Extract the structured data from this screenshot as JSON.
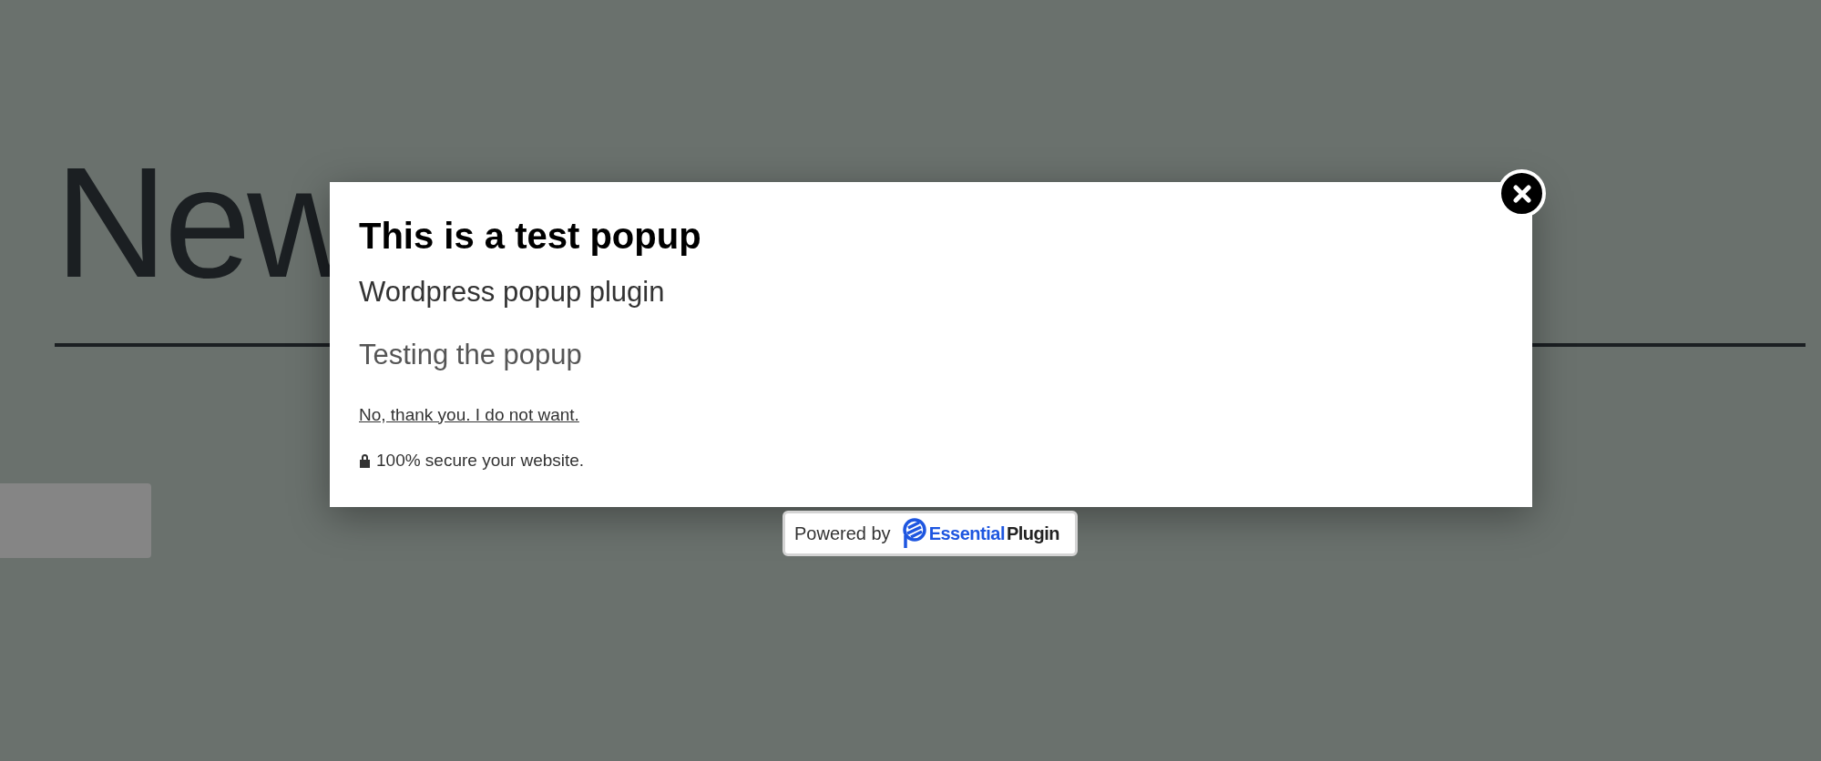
{
  "page": {
    "heading": "New"
  },
  "popup": {
    "title": "This is a test popup",
    "subtitle": "Wordpress popup plugin",
    "body": "Testing the popup",
    "decline_link": "No, thank you. I do not want.",
    "security_note": "100% secure your website."
  },
  "powered_by": {
    "label": "Powered by",
    "brand_first": "Essential",
    "brand_second": "Plugin"
  }
}
